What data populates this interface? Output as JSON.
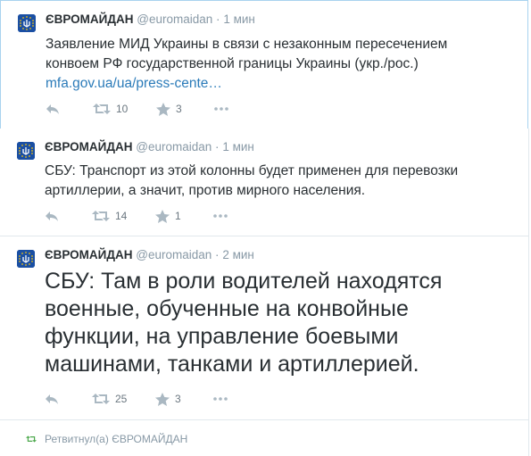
{
  "tweets": [
    {
      "fullname": "ЄВРОМАЙДАН",
      "username": "@euromaidan",
      "separator": "·",
      "time": "1 мин",
      "text_lines": [
        "Заявление МИД Украины в связи с незаконным пересечением",
        "конвоем РФ государственной границы Украины (укр./рос.)"
      ],
      "link": "mfa.gov.ua/ua/press-cente…",
      "retweets": "10",
      "favorites": "3"
    },
    {
      "fullname": "ЄВРОМАЙДАН",
      "username": "@euromaidan",
      "separator": "·",
      "time": "1 мин",
      "text_lines": [
        "СБУ: Транспорт из этой колонны будет применен для перевозки",
        "артиллерии, а значит, против мирного населения."
      ],
      "retweets": "14",
      "favorites": "1"
    },
    {
      "fullname": "ЄВРОМАЙДАН",
      "username": "@euromaidan",
      "separator": "·",
      "time": "2 мин",
      "text_lines": [
        "СБУ: Там в роли водителей находятся",
        "военные, обученные на конвойные",
        "функции, на управление боевыми",
        "машинами, танками и артиллерией."
      ],
      "retweets": "25",
      "favorites": "3"
    }
  ],
  "retweet_context": "Ретвитнул(а) ЄВРОМАЙДАН",
  "colors": {
    "link": "#2b7bb9",
    "meta": "#8899a6",
    "retweet_green": "#4ca84c",
    "focus_border": "#a8d2ef"
  },
  "icons": [
    "avatar-trident-logo",
    "reply-icon",
    "retweet-icon",
    "favorite-star-icon",
    "more-dots-icon"
  ]
}
